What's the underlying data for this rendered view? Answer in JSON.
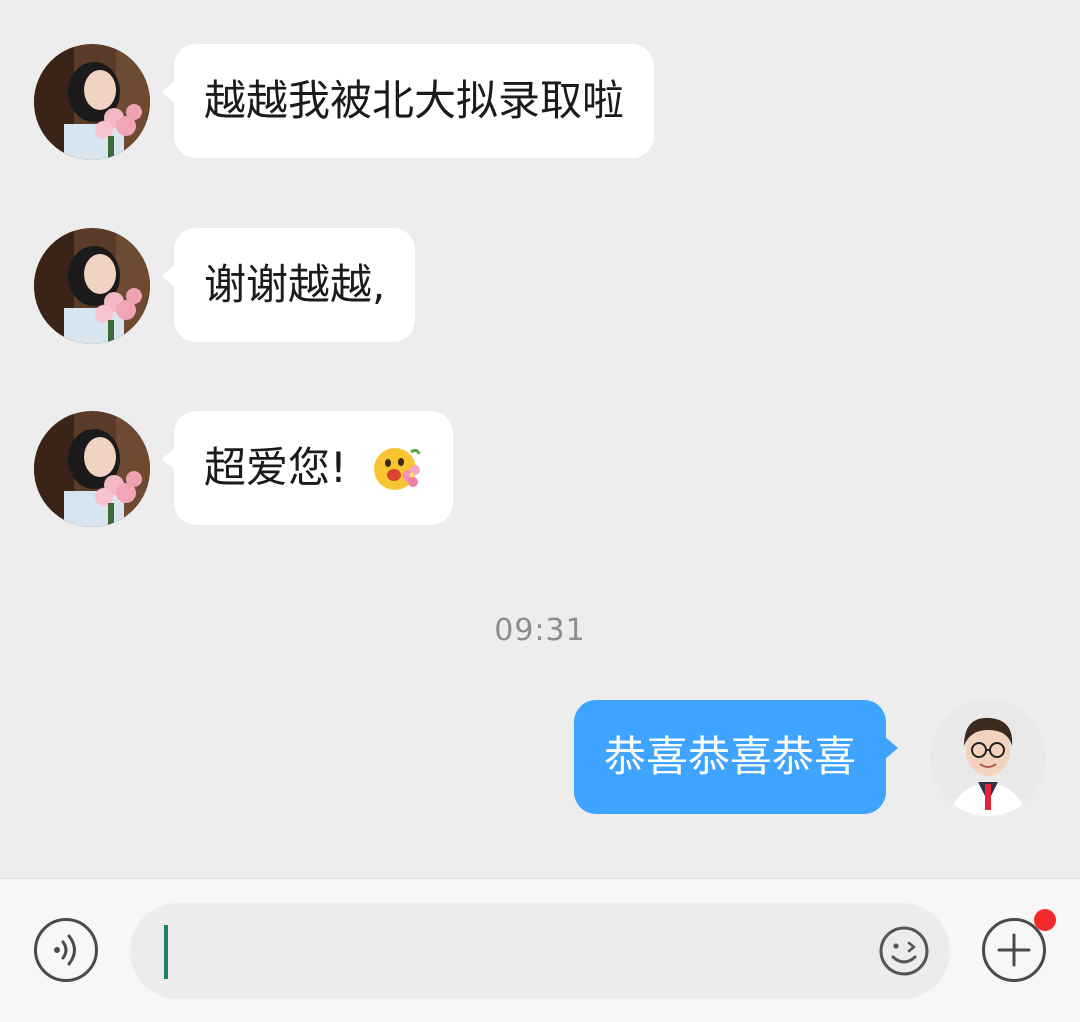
{
  "conversation": {
    "incoming": [
      {
        "text": "越越我被北大拟录取啦",
        "emoji": ""
      },
      {
        "text": "谢谢越越,",
        "emoji": ""
      },
      {
        "text": "超爱您!",
        "emoji": "flower-hug-emoji"
      }
    ],
    "timestamp": "09:31",
    "outgoing": [
      {
        "text": "恭喜恭喜恭喜"
      }
    ]
  },
  "input_bar": {
    "value": "",
    "voice_icon": "voice-icon",
    "emoji_icon": "smiley-icon",
    "more_icon": "plus-icon",
    "more_badge": true
  },
  "colors": {
    "background": "#ededed",
    "incoming_bubble": "#ffffff",
    "outgoing_bubble": "#3fa4ff",
    "badge": "#f52a2a",
    "caret": "#1e7f6e"
  }
}
